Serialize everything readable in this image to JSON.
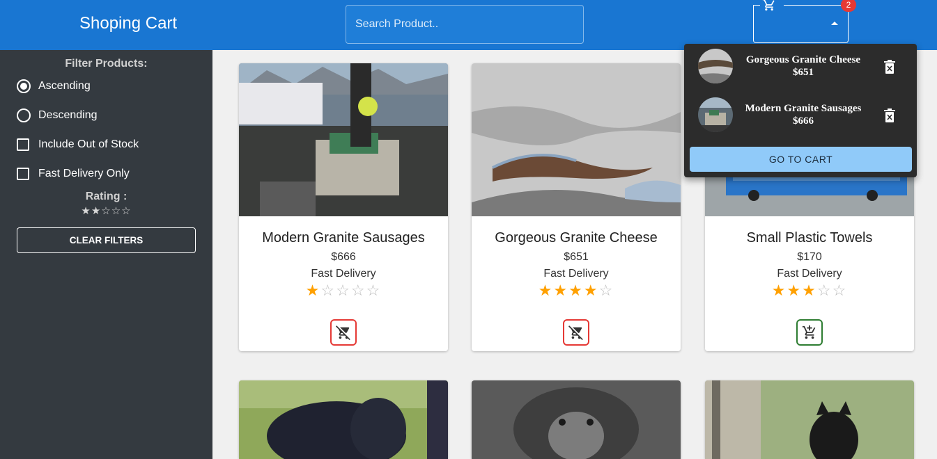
{
  "header": {
    "title": "Shoping Cart",
    "search_placeholder": "Search Product..",
    "cart_count": "2"
  },
  "sidebar": {
    "filter_title": "Filter Products:",
    "options": {
      "ascending": "Ascending",
      "descending": "Descending",
      "include_out_of_stock": "Include Out of Stock",
      "fast_delivery_only": "Fast Delivery Only"
    },
    "sort_selected": "ascending",
    "rating_label": "Rating :",
    "rating_value": 2,
    "clear_label": "CLEAR FILTERS"
  },
  "products": [
    {
      "name": "Modern Granite Sausages",
      "price": "$666",
      "delivery": "Fast Delivery",
      "rating": 1,
      "in_cart": true
    },
    {
      "name": "Gorgeous Granite Cheese",
      "price": "$651",
      "delivery": "Fast Delivery",
      "rating": 4,
      "in_cart": true
    },
    {
      "name": "Small Plastic Towels",
      "price": "$170",
      "delivery": "Fast Delivery",
      "rating": 3,
      "in_cart": false
    }
  ],
  "cart_dropdown": {
    "items": [
      {
        "name": "Gorgeous Granite Cheese",
        "price": "$651"
      },
      {
        "name": "Modern Granite Sausages",
        "price": "$666"
      }
    ],
    "go_label": "GO TO CART"
  },
  "colors": {
    "header": "#1976d2",
    "sidebar": "#343a40",
    "star": "#ffa000",
    "remove": "#e53935",
    "add": "#2e7d32",
    "go_button": "#90caf9"
  }
}
